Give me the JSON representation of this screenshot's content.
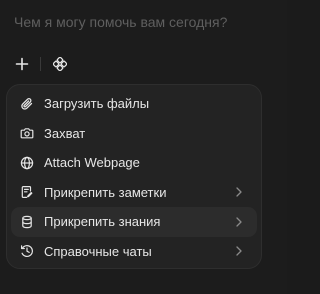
{
  "input": {
    "placeholder": "Чем я могу помочь вам сегодня?"
  },
  "toolbar": {
    "add_icon": "plus-icon",
    "tools_icon": "tools-icon"
  },
  "menu": {
    "items": [
      {
        "label": "Загрузить файлы",
        "icon": "paperclip-icon",
        "has_submenu": false
      },
      {
        "label": "Захват",
        "icon": "camera-icon",
        "has_submenu": false
      },
      {
        "label": "Attach Webpage",
        "icon": "globe-icon",
        "has_submenu": false
      },
      {
        "label": "Прикрепить заметки",
        "icon": "note-icon",
        "has_submenu": true
      },
      {
        "label": "Прикрепить знания",
        "icon": "database-icon",
        "has_submenu": true
      },
      {
        "label": "Справочные чаты",
        "icon": "clock-icon",
        "has_submenu": true
      }
    ],
    "highlighted_index": 4
  },
  "colors": {
    "background": "#1c1c1c",
    "menu_background": "#232323",
    "highlight": "#2c2c2c",
    "text": "#e6e6e6",
    "placeholder": "#5f5f5f"
  }
}
